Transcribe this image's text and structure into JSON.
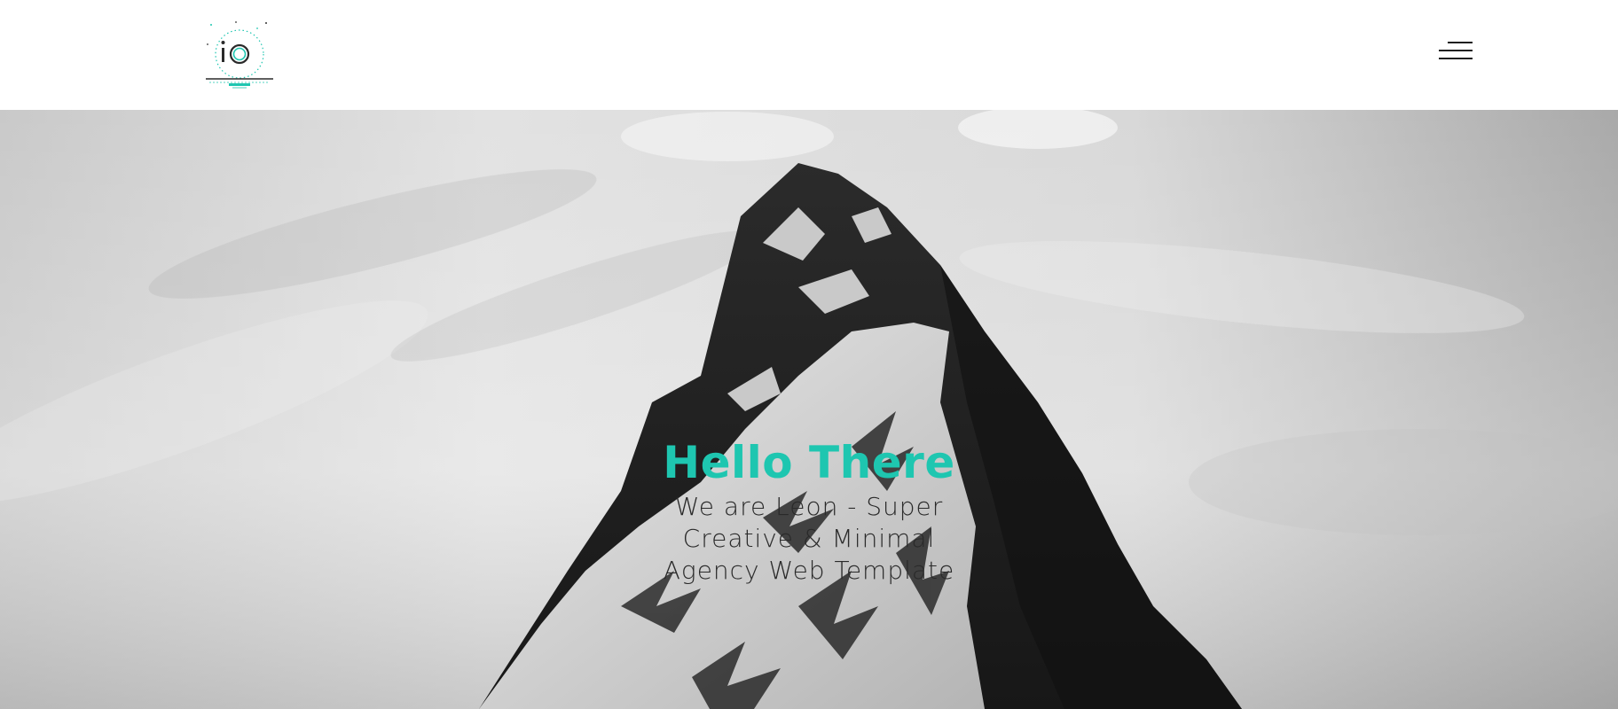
{
  "header": {
    "logo_text": "iO",
    "menu_icon": "hamburger-menu-icon"
  },
  "hero": {
    "title": "Hello There",
    "subtitle": "We are Leon - Super Creative & Minimal Agency Web Template"
  },
  "colors": {
    "accent": "#1ec6b0",
    "text_dark": "#2a2a2a",
    "header_bg": "#ffffff"
  }
}
